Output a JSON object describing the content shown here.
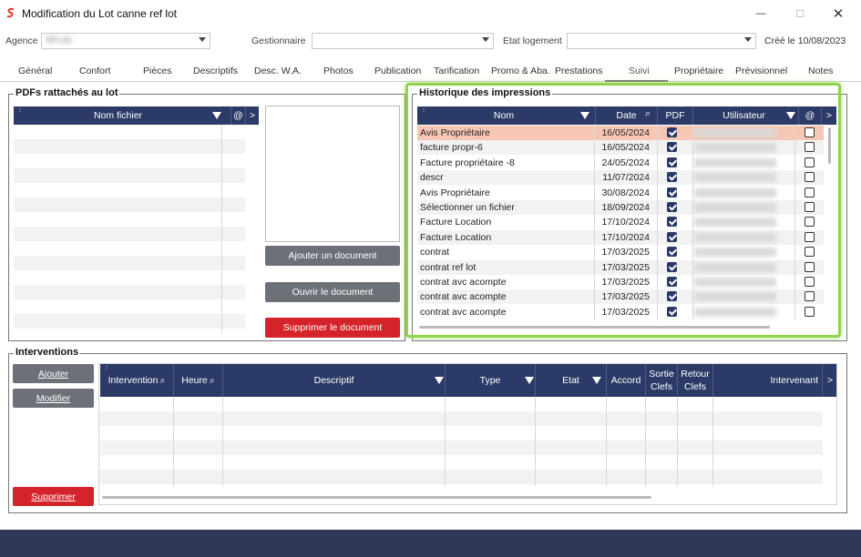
{
  "window": {
    "title": "Modification du Lot canne ref lot",
    "minimize": "—",
    "maximize": "☐",
    "close": "✕"
  },
  "header": {
    "agence_label": "Agence",
    "agence_value": "SFLIG",
    "gestionnaire_label": "Gestionnaire",
    "gestionnaire_value": "",
    "etat_label": "Etat logement",
    "etat_value": "",
    "created": "Créé le 10/08/2023"
  },
  "tabs": [
    "Général",
    "Confort",
    "Pièces",
    "Descriptifs",
    "Desc. W.A.",
    "Photos",
    "Publication",
    "Tarification",
    "Promo & Aba.",
    "Prestations",
    "Suivi",
    "Propriétaire",
    "Prévisionnel",
    "Notes"
  ],
  "active_tab": "Suivi",
  "pdfs": {
    "title": "PDFs rattachés au lot",
    "col_nom": "Nom fichier",
    "col_at": "@",
    "more": ">",
    "btn_add": "Ajouter un document",
    "btn_open": "Ouvrir le document",
    "btn_delete": "Supprimer le document"
  },
  "historique": {
    "title": "Historique des impressions",
    "col_nom": "Nom",
    "col_date": "Date",
    "col_pdf": "PDF",
    "col_user": "Utilisateur",
    "col_at": "@",
    "more": ">",
    "rows": [
      {
        "nom": "Avis Propriétaire",
        "date": "16/05/2024",
        "pdf": true,
        "at": false
      },
      {
        "nom": "facture propr-6",
        "date": "16/05/2024",
        "pdf": true,
        "at": false
      },
      {
        "nom": "Facture propriétaire -8",
        "date": "24/05/2024",
        "pdf": true,
        "at": false
      },
      {
        "nom": "descr",
        "date": "11/07/2024",
        "pdf": true,
        "at": false
      },
      {
        "nom": "Avis Propriétaire",
        "date": "30/08/2024",
        "pdf": true,
        "at": false
      },
      {
        "nom": "Sélectionner un fichier",
        "date": "18/09/2024",
        "pdf": true,
        "at": false
      },
      {
        "nom": "Facture Location",
        "date": "17/10/2024",
        "pdf": true,
        "at": false
      },
      {
        "nom": "Facture Location",
        "date": "17/10/2024",
        "pdf": true,
        "at": false
      },
      {
        "nom": "contrat",
        "date": "17/03/2025",
        "pdf": true,
        "at": false
      },
      {
        "nom": "contrat ref lot",
        "date": "17/03/2025",
        "pdf": true,
        "at": false
      },
      {
        "nom": "contrat avc acompte",
        "date": "17/03/2025",
        "pdf": true,
        "at": false
      },
      {
        "nom": "contrat avc acompte",
        "date": "17/03/2025",
        "pdf": true,
        "at": false
      },
      {
        "nom": "contrat avc acompte",
        "date": "17/03/2025",
        "pdf": true,
        "at": false
      }
    ]
  },
  "interventions": {
    "title": "Interventions",
    "btn_add": "Ajouter",
    "btn_edit": "Modifier",
    "btn_delete": "Supprimer",
    "col_intervention": "Intervention",
    "col_heure": "Heure",
    "col_descriptif": "Descriptif",
    "col_type": "Type",
    "col_etat": "Etat",
    "col_accord": "Accord",
    "col_sortie": "Sortie Clefs",
    "col_retour": "Retour Clefs",
    "col_intervenant": "Intervenant",
    "more": ">"
  },
  "colors": {
    "header_bg": "#2b3a67",
    "highlight_row": "#f7c7b6",
    "danger": "#d4232a",
    "gray_button": "#6c7078",
    "focus_frame": "#8ed34a"
  }
}
